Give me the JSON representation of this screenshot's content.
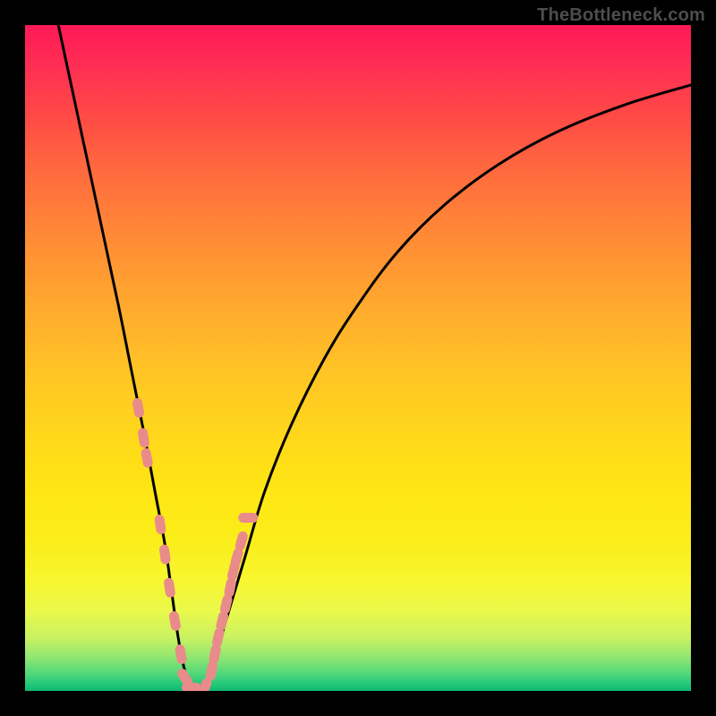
{
  "watermark": "TheBottleneck.com",
  "chart_data": {
    "type": "line",
    "title": "",
    "xlabel": "",
    "ylabel": "",
    "xlim": [
      0,
      100
    ],
    "ylim": [
      0,
      100
    ],
    "grid": false,
    "legend": false,
    "series": [
      {
        "name": "curve",
        "style": "smooth",
        "color": "#000000",
        "x": [
          5,
          8,
          11,
          14,
          16,
          18,
          19.5,
          21,
          22,
          23,
          24,
          25,
          27,
          28,
          30,
          33,
          36,
          40,
          45,
          50,
          56,
          63,
          71,
          80,
          90,
          100
        ],
        "values": [
          100,
          86,
          72,
          58,
          48,
          38,
          30,
          22,
          15,
          8,
          3,
          0.5,
          0.5,
          3,
          10,
          20,
          30,
          40,
          50,
          58,
          66,
          73,
          79,
          84,
          88,
          91
        ]
      },
      {
        "name": "markers",
        "style": "scatter-pill",
        "color": "#e98b8b",
        "x": [
          17.0,
          17.8,
          18.3,
          20.3,
          21.0,
          21.7,
          22.5,
          23.4,
          24.0,
          25.0,
          27.0,
          28.0,
          28.5,
          29.0,
          29.6,
          30.2,
          30.8,
          31.3,
          31.8,
          32.5,
          33.5
        ],
        "values": [
          42.5,
          38.0,
          35.0,
          25.0,
          20.5,
          15.5,
          10.5,
          5.5,
          2.0,
          0.5,
          0.5,
          3.0,
          5.5,
          8.0,
          10.5,
          13.0,
          15.5,
          18.0,
          20.0,
          22.5,
          26.0
        ]
      }
    ]
  }
}
